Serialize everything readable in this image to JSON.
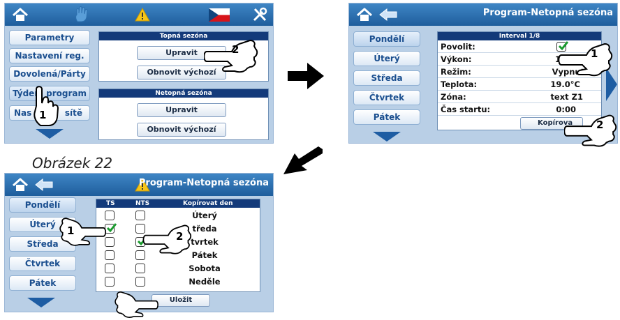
{
  "colors": {
    "accent": "#1e5d9c",
    "panel_bg": "#b9cfe6",
    "header_dark": "#133a7a",
    "check_green": "#1a9b2e"
  },
  "panel1": {
    "side_items": [
      "Parametry",
      "Nastavení reg.",
      "Dovolená/Párty",
      "Týdenní program",
      "Nastavení sítě"
    ],
    "side_item_4_visible": "Týden",
    "side_item_4_visible_tail": "program",
    "side_item_5_visible": "Nas",
    "side_item_5_visible_tail": "sítě",
    "topna_title": "Topná sezóna",
    "netopna_title": "Netopná sezóna",
    "upravit_label": "Upravit",
    "obnovit_label": "Obnovit výchozí",
    "icons": [
      "home-icon",
      "hand-icon",
      "warning-icon",
      "flag-icon",
      "tools-icon"
    ]
  },
  "panel2": {
    "title": "Program-Netopná sezóna",
    "days": [
      "Pondělí",
      "Úterý",
      "Středa",
      "Čtvrtek",
      "Pátek"
    ],
    "interval_title": "Interval 1/8",
    "rows": [
      {
        "label": "Povolit:",
        "value": ""
      },
      {
        "label": "Výkon:",
        "value": "13"
      },
      {
        "label": "Režim:",
        "value": "Vypnuto"
      },
      {
        "label": "Teplota:",
        "value": "19.0°C"
      },
      {
        "label": "Zóna:",
        "value": "text Z1"
      },
      {
        "label": "Čas startu:",
        "value": "0:00"
      }
    ],
    "copy_label": "Kopírova"
  },
  "panel3": {
    "title": "Program-Netopná sezóna",
    "days": [
      "Pondělí",
      "Úterý",
      "Středa",
      "Čtvrtek",
      "Pátek"
    ],
    "col_ts": "TS",
    "col_nts": "NTS",
    "col_copy": "Kopírovat den",
    "copy_days": [
      "Úterý",
      "Středa",
      "Čtvrtek",
      "Pátek",
      "Sobota",
      "Neděle"
    ],
    "copy_days_visible": [
      "Úterý",
      "tředa",
      "tvrtek",
      "Pátek",
      "Sobota",
      "Neděle"
    ],
    "ts_checked": [
      false,
      true,
      false,
      false,
      false,
      false
    ],
    "nts_checked": [
      false,
      false,
      true,
      false,
      false,
      false
    ],
    "save_label": "Uložit"
  },
  "callouts": {
    "one": "1",
    "two": "2"
  },
  "caption": "Obrázek 22"
}
